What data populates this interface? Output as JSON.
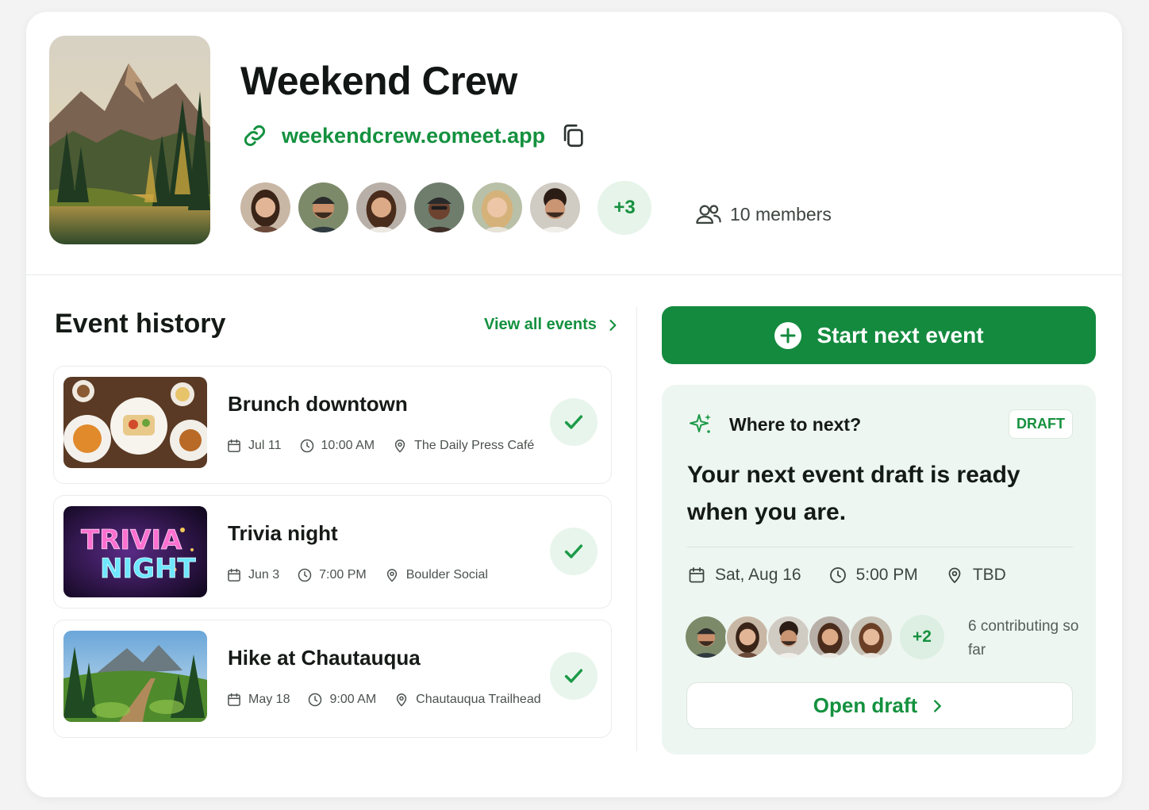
{
  "group": {
    "title": "Weekend Crew",
    "link": "weekendcrew.eomeet.app",
    "more_members": "+3",
    "members_count": "10 members"
  },
  "history": {
    "title": "Event history",
    "view_all": "View all events",
    "events": [
      {
        "title": "Brunch downtown",
        "date": "Jul 11",
        "time": "10:00 AM",
        "place": "The Daily Press Café",
        "status": "done"
      },
      {
        "title": "Trivia night",
        "date": "Jun 3",
        "time": "7:00 PM",
        "place": "Boulder Social",
        "status": "done"
      },
      {
        "title": "Hike at Chautauqua",
        "date": "May 18",
        "time": "9:00 AM",
        "place": "Chautauqua Trailhead",
        "status": "done"
      }
    ]
  },
  "next": {
    "start_label": "Start next event",
    "heading": "Where to next?",
    "badge": "DRAFT",
    "text": "Your next event draft is ready when you are.",
    "date": "Sat, Aug 16",
    "time": "5:00 PM",
    "place": "TBD",
    "more_contributors": "+2",
    "contributing": "6 contributing so far",
    "open_label": "Open draft"
  },
  "trivia_sign": {
    "line1": "TRIVIA",
    "line2": "NIGHT"
  },
  "colors": {
    "accent": "#138a3e",
    "accent_text": "#14913f",
    "soft_green": "#e8f5ec",
    "panel": "#eef6f1"
  },
  "icons": [
    "link-icon",
    "copy-icon",
    "members-icon",
    "chevron-right-icon",
    "calendar-icon",
    "clock-icon",
    "location-pin-icon",
    "check-icon",
    "plus-circle-icon",
    "sparkle-icon"
  ]
}
